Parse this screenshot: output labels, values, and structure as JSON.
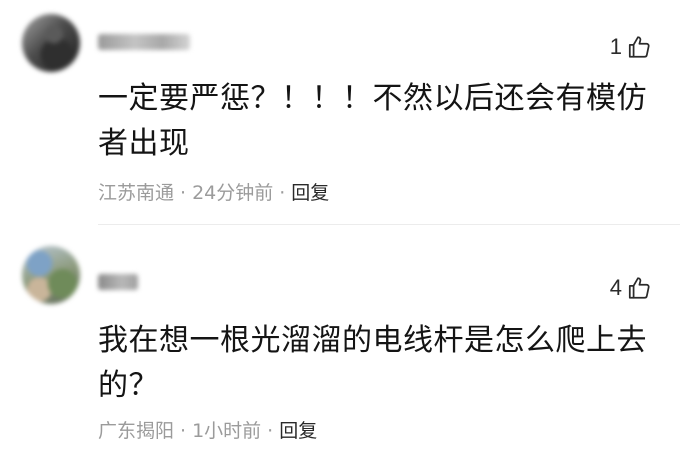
{
  "comments": [
    {
      "like_count": "1",
      "content": "一定要严惩？！！！不然以后还会有模仿者出现",
      "location": "江苏南通",
      "time": "24分钟前",
      "reply_label": "回复"
    },
    {
      "like_count": "4",
      "content": "我在想一根光溜溜的电线杆是怎么爬上去的？",
      "location": "广东揭阳",
      "time": "1小时前",
      "reply_label": "回复"
    }
  ],
  "separator": "·",
  "icons": {
    "like": "thumbs-up-icon"
  }
}
